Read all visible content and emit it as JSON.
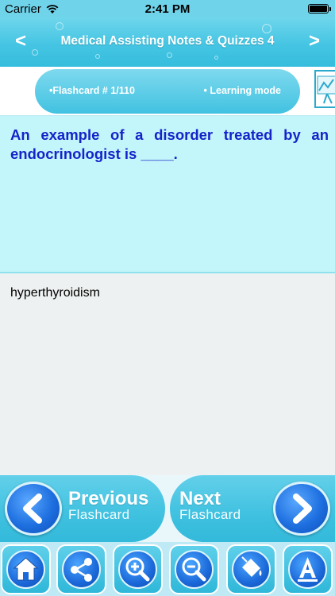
{
  "status_bar": {
    "carrier": "Carrier",
    "time": "2:41 PM"
  },
  "nav": {
    "title": "Medical Assisting Notes & Quizzes 4",
    "back_label": "<",
    "forward_label": ">"
  },
  "info": {
    "flashcard_label": "•Flashcard #  1/110",
    "mode_label": "• Learning mode"
  },
  "question": "An example of a disorder treated by an endocrinologist is ____.",
  "answer": "hyperthyroidism",
  "card_nav": {
    "previous": {
      "line1": "Previous",
      "line2": "Flashcard"
    },
    "next": {
      "line1": "Next",
      "line2": "Flashcard"
    }
  },
  "toolbar": {
    "items": [
      "home-icon",
      "share-icon",
      "zoom-in-icon",
      "zoom-out-icon",
      "paint-bucket-icon",
      "font-icon"
    ]
  },
  "colors": {
    "accent": "#41c2e1",
    "question_text": "#1523c9",
    "question_bg": "#c3f6fb",
    "answer_bg": "#eef1f1"
  }
}
